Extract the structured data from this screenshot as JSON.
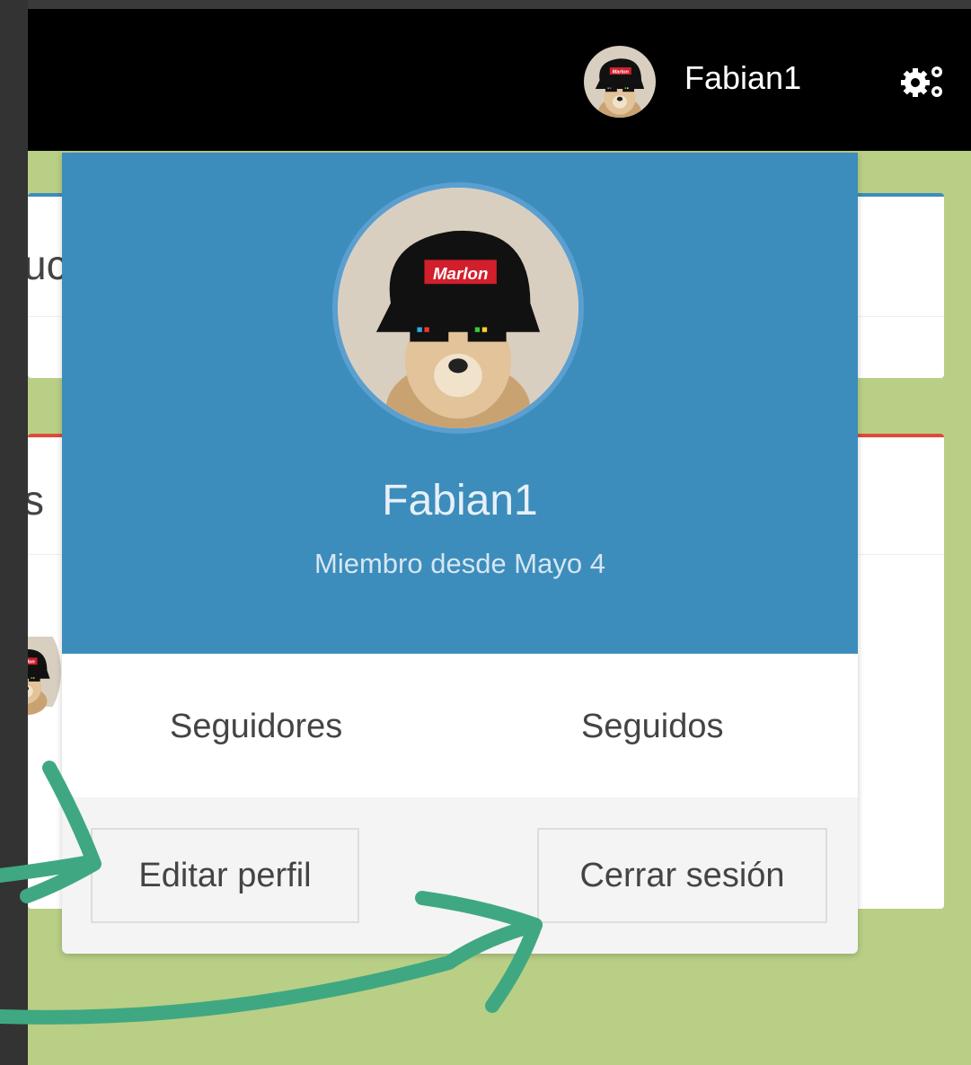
{
  "navbar": {
    "username": "Fabian1",
    "avatar_icon": "user-avatar",
    "settings_icon": "gears-icon"
  },
  "background": {
    "fragment_text_1": "uc",
    "fragment_text_2": "s"
  },
  "dropdown": {
    "username": "Fabian1",
    "member_since": "Miembro desde Mayo 4",
    "avatar_cap_text": "Marlon",
    "followers_label": "Seguidores",
    "following_label": "Seguidos",
    "edit_profile_label": "Editar perfil",
    "logout_label": "Cerrar sesión"
  },
  "colors": {
    "navbar": "#000000",
    "header": "#3c8dbc",
    "background": "#b9cf86",
    "annotation_arrow": "#3fa882"
  }
}
